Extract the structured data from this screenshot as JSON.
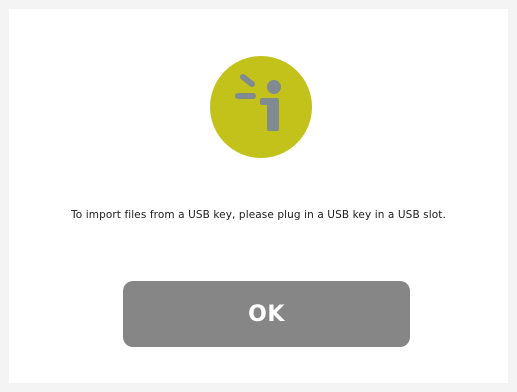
{
  "dialog": {
    "icon": "info-icon",
    "icon_color": "#c3c21a",
    "icon_glyph_color": "#808b91",
    "message": "To import files from a USB key, please plug in a USB key in a USB slot.",
    "ok_label": "OK",
    "button_color": "#868686"
  }
}
